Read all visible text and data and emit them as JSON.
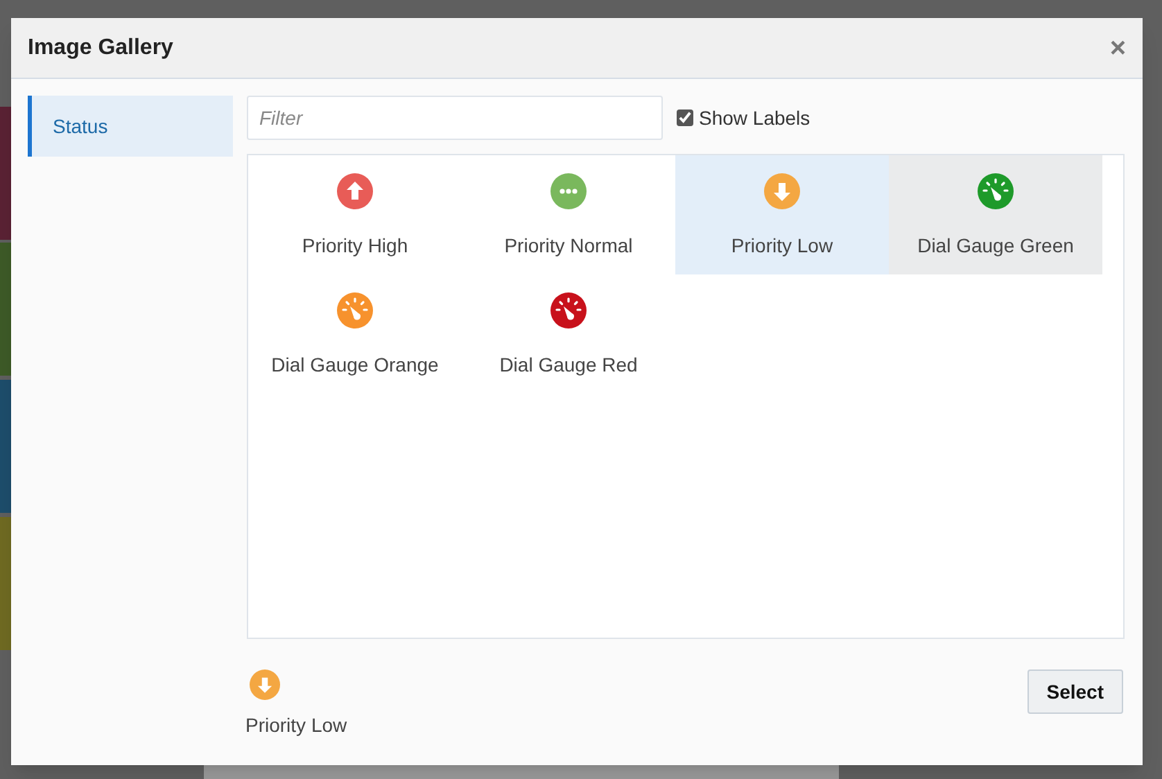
{
  "dialog": {
    "title": "Image Gallery",
    "close": "×",
    "categories": [
      {
        "label": "Status",
        "selected": true
      }
    ],
    "filter": {
      "placeholder": "Filter"
    },
    "show_labels": {
      "label": "Show Labels",
      "checked": true
    },
    "images": [
      {
        "label": "Priority High",
        "kind": "arrow-up",
        "color": "#e85c57",
        "selected": false,
        "hovered": false
      },
      {
        "label": "Priority Normal",
        "kind": "dots",
        "color": "#7ab85d",
        "selected": false,
        "hovered": false
      },
      {
        "label": "Priority Low",
        "kind": "arrow-down",
        "color": "#f4a742",
        "selected": true,
        "hovered": false
      },
      {
        "label": "Dial Gauge Green",
        "kind": "gauge",
        "color": "#1e9a2a",
        "selected": false,
        "hovered": true
      },
      {
        "label": "Dial Gauge Orange",
        "kind": "gauge",
        "color": "#f7922d",
        "selected": false,
        "hovered": false
      },
      {
        "label": "Dial Gauge Red",
        "kind": "gauge",
        "color": "#c8111b",
        "selected": false,
        "hovered": false
      }
    ],
    "preview": {
      "label": "Priority Low",
      "kind": "arrow-down",
      "color": "#f4a742"
    },
    "button": "Select"
  }
}
